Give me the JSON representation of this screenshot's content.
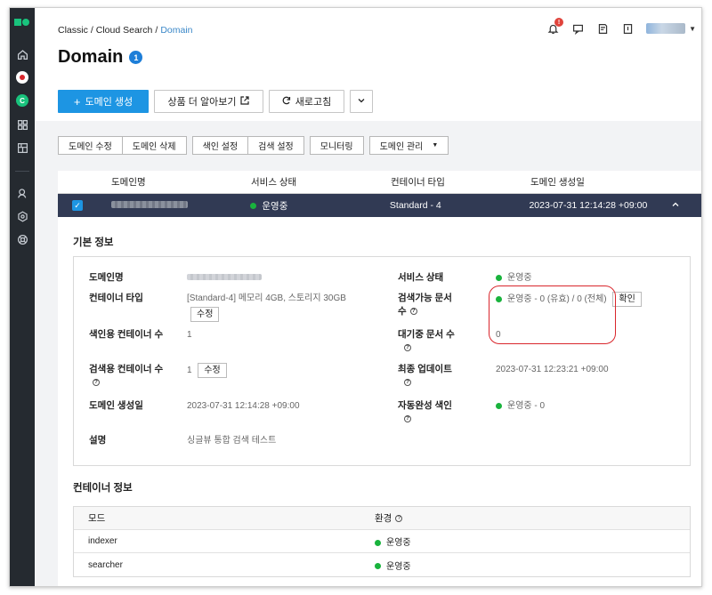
{
  "breadcrumb": {
    "items": [
      "Classic",
      "Cloud Search"
    ],
    "current": "Domain",
    "separator": "/"
  },
  "notification_count": "!",
  "page": {
    "title": "Domain",
    "count": "1"
  },
  "actions": {
    "create": "도메인 생성",
    "learn_more": "상품 더 알아보기",
    "refresh": "새로고침"
  },
  "tabs": {
    "edit": "도메인 수정",
    "delete": "도메인 삭제",
    "index_settings": "색인 설정",
    "search_settings": "검색 설정",
    "monitoring": "모니터링",
    "manage": "도메인 관리"
  },
  "table": {
    "headers": [
      "도메인명",
      "서비스 상태",
      "컨테이너 타입",
      "도메인 생성일"
    ],
    "row": {
      "status": "운영중",
      "container_type": "Standard - 4",
      "created": "2023-07-31 12:14:28 +09:00"
    }
  },
  "basic_info": {
    "title": "기본 정보",
    "domain_name_label": "도메인명",
    "container_type_label": "컨테이너 타입",
    "container_type_value": "[Standard-4] 메모리 4GB, 스토리지 30GB",
    "edit_label": "수정",
    "indexing_containers_label": "색인용 컨테이너 수",
    "indexing_containers_value": "1",
    "search_containers_label": "검색용 컨테이너 수",
    "search_containers_value": "1",
    "created_label": "도메인 생성일",
    "created_value": "2023-07-31 12:14:28 +09:00",
    "description_label": "설명",
    "description_value": "싱글뷰 통합 검색 테스트",
    "service_status_label": "서비스 상태",
    "service_status_value": "운영중",
    "searchable_docs_label": "검색가능 문서 수",
    "searchable_docs_value": "운영중 - 0 (유효) / 0 (전체)",
    "confirm_label": "확인",
    "pending_docs_label": "대기중 문서 수",
    "pending_docs_value": "0",
    "last_update_label": "최종 업데이트",
    "last_update_value": "2023-07-31 12:23:21 +09:00",
    "autocomplete_label": "자동완성 색인",
    "autocomplete_value": "운영중 - 0"
  },
  "container_info": {
    "title": "컨테이너 정보",
    "headers": [
      "모드",
      "환경"
    ],
    "rows": [
      {
        "mode": "indexer",
        "env": "운영중"
      },
      {
        "mode": "searcher",
        "env": "운영중"
      }
    ]
  },
  "colors": {
    "primary": "#1d95e3",
    "sidebar": "#252a30",
    "selected_row": "#313a54",
    "status_green": "#19b33d",
    "highlight": "#d9262c"
  }
}
